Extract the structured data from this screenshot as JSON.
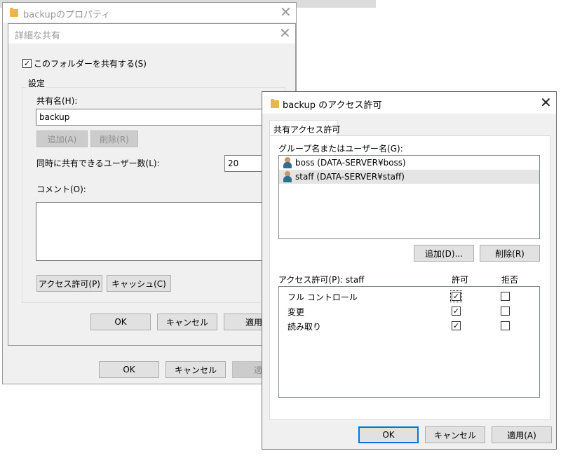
{
  "background_window": {
    "text": "backupのプロパティ"
  },
  "properties_window": {
    "title": "backupのプロパティ",
    "buttons": {
      "ok": "OK",
      "cancel": "キャンセル",
      "apply": "適用"
    }
  },
  "advanced_sharing": {
    "title": "詳細な共有",
    "share_folder_checkbox": {
      "label": "このフォルダーを共有する(S)",
      "checked": true
    },
    "settings_group": "設定",
    "share_name_label": "共有名(H):",
    "share_name_value": "backup",
    "add_label": "追加(A)",
    "remove_label": "削除(R)",
    "user_limit_label": "同時に共有できるユーザー数(L):",
    "user_limit_value": "20",
    "comment_label": "コメント(O):",
    "permissions_button": "アクセス許可(P)",
    "caching_button": "キャッシュ(C)",
    "buttons": {
      "ok": "OK",
      "cancel": "キャンセル",
      "apply": "適用"
    }
  },
  "permissions_dialog": {
    "title": "backup のアクセス許可",
    "tab": "共有アクセス許可",
    "group_label": "グループ名またはユーザー名(G):",
    "users": [
      {
        "name": "boss (DATA-SERVER¥boss)",
        "icon": "user-icon",
        "selected": false
      },
      {
        "name": "staff (DATA-SERVER¥staff)",
        "icon": "user-icon",
        "selected": true
      }
    ],
    "add_button": "追加(D)...",
    "remove_button": "削除(R)",
    "permissions_for_label": "アクセス許可(P): staff",
    "allow_header": "許可",
    "deny_header": "拒否",
    "permissions": [
      {
        "name": "フル コントロール",
        "allow": true,
        "deny": false
      },
      {
        "name": "変更",
        "allow": true,
        "deny": false
      },
      {
        "name": "読み取り",
        "allow": true,
        "deny": false
      }
    ],
    "buttons": {
      "ok": "OK",
      "cancel": "キャンセル",
      "apply": "適用(A)"
    }
  },
  "colors": {
    "accent": "#0078d7",
    "dialog_bg": "#f0f0f0",
    "selection": "#e5e5e5"
  }
}
